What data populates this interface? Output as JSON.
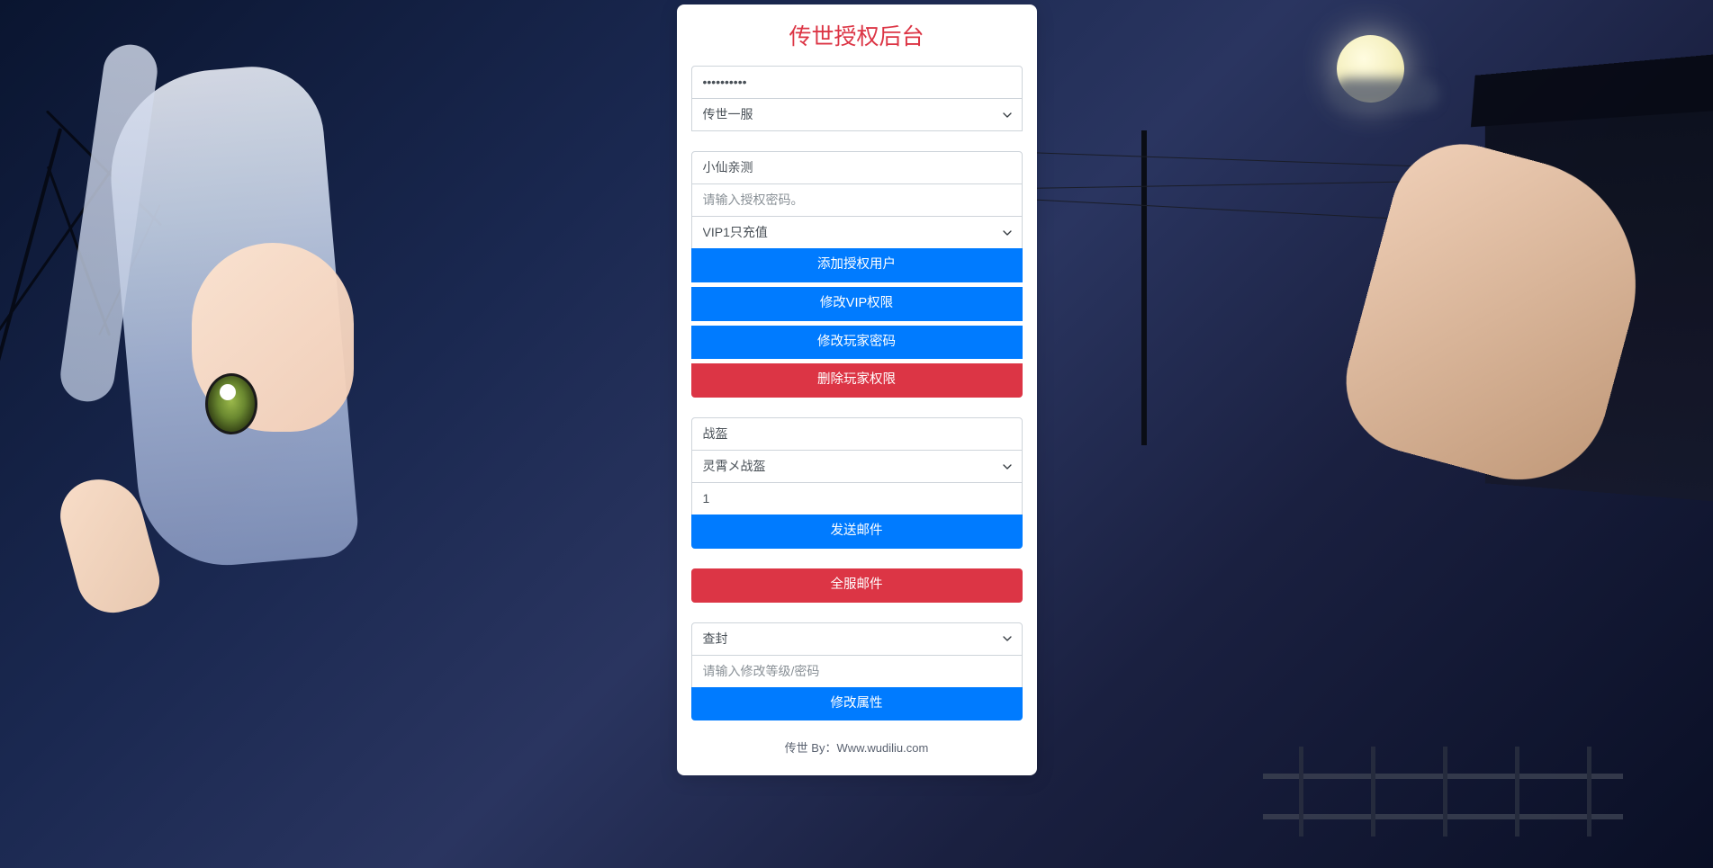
{
  "title": "传世授权后台",
  "section1": {
    "password_value": "••••••••••",
    "server_select": "传世一服"
  },
  "section2": {
    "user_value": "小仙亲测",
    "authcode_placeholder": "请输入授权密码。",
    "vip_select": "VIP1只充值",
    "btn_add_user": "添加授权用户",
    "btn_modify_vip": "修改VIP权限",
    "btn_modify_password": "修改玩家密码",
    "btn_delete_perm": "删除玩家权限"
  },
  "section3": {
    "item_value": "战盔",
    "item_select": "灵霄メ战盔",
    "qty_value": "1",
    "btn_send_mail": "发送邮件"
  },
  "section4": {
    "btn_all_mail": "全服邮件"
  },
  "section5": {
    "action_select": "查封",
    "level_placeholder": "请输入修改等级/密码",
    "btn_modify_attr": "修改属性"
  },
  "footer": "传世 By：Www.wudiliu.com"
}
